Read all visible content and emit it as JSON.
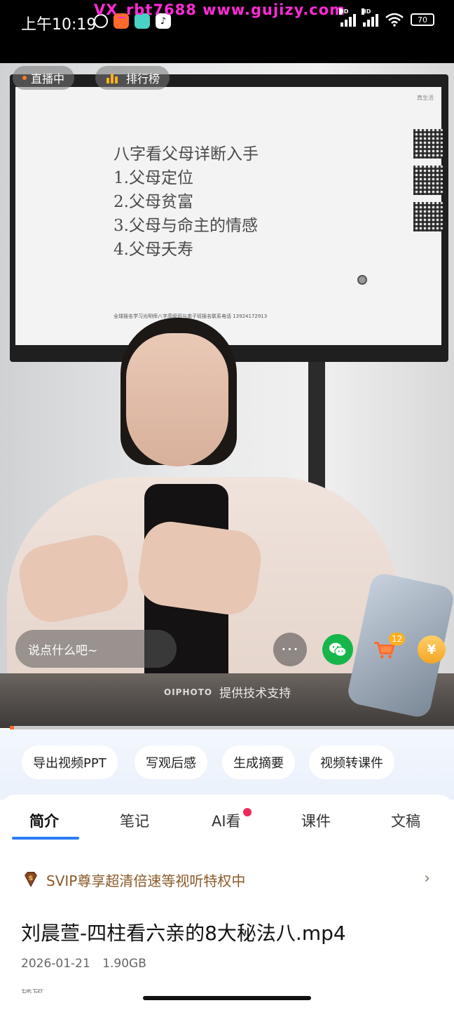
{
  "status_bar": {
    "time": "上午10:19",
    "watermark": "VX_rbt7688   www.gujizy.com",
    "battery": "70",
    "signal_label": "HD"
  },
  "video": {
    "live_label": "直播中",
    "rank_label": "排行榜",
    "slide": {
      "title": "八字看父母详断入手",
      "items": [
        "1.父母定位",
        "2.父母贫富",
        "3.父母与命主的情感",
        "4.父母夭寿"
      ],
      "footer": "全球报名学习光明师八字高级班与弟子班报名联系电话 13924172913",
      "logo": "真生活"
    },
    "comment_placeholder": "说点什么吧~",
    "more_icon": "···",
    "cart_badge": "12",
    "coin_symbol": "¥",
    "tech_logo": "OIPHOTO",
    "tech_support": "提供技术支持",
    "progress": 0.01
  },
  "quick_actions": [
    "导出视频PPT",
    "写观后感",
    "生成摘要",
    "视频转课件"
  ],
  "tabs": {
    "items": [
      "简介",
      "笔记",
      "AI看",
      "课件",
      "文稿"
    ],
    "active_index": 0
  },
  "svip": {
    "text": "SVIP尊享超清倍速等视听特权中",
    "chevron": "›"
  },
  "file": {
    "title": "刘晨萱-四柱看六亲的8大秘法八.mp4",
    "date": "2026-01-21",
    "size": "1.90GB",
    "cutoff": "播放"
  },
  "colors": {
    "accent_blue": "#2d7cf6",
    "progress_orange": "#ff6a2a",
    "svip_brown": "#8a5a2a",
    "badge_red": "#ee2a5a",
    "wechat_green": "#16b64a"
  }
}
